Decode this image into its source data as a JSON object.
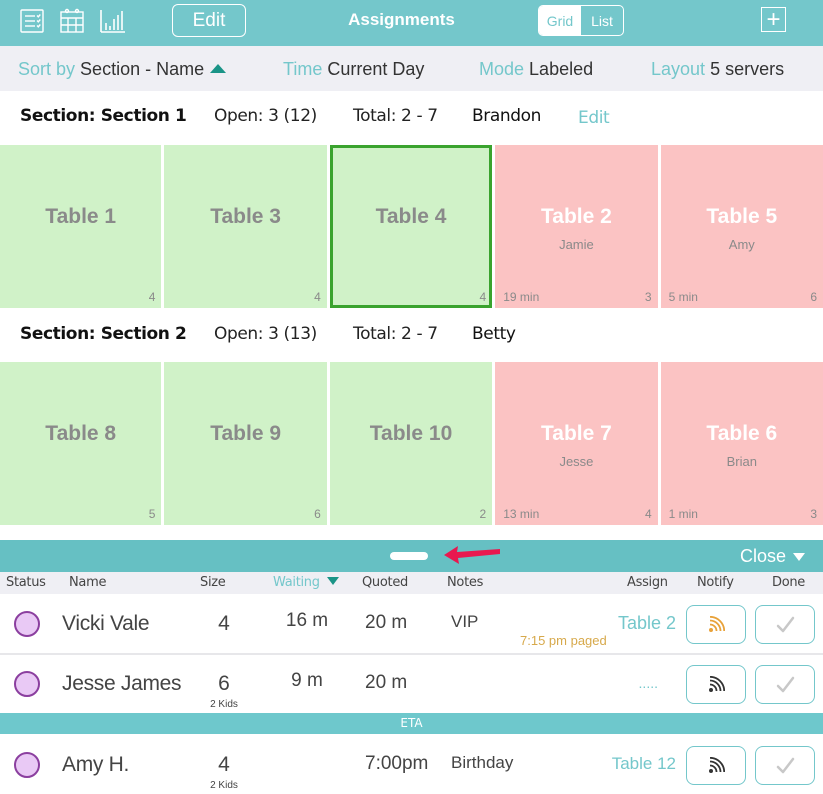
{
  "topbar": {
    "title": "Assignments",
    "edit_label": "Edit",
    "view_toggle": {
      "options": [
        "Grid",
        "List"
      ],
      "selected": "Grid"
    },
    "add_label": "+",
    "icons": [
      "waitlist-icon",
      "calendar-icon",
      "chart-icon",
      "add-icon"
    ]
  },
  "filters": {
    "sort": {
      "label": "Sort by",
      "value": "Section - Name",
      "direction": "ascending"
    },
    "time": {
      "label": "Time",
      "value": "Current Day"
    },
    "mode": {
      "label": "Mode",
      "value": "Labeled"
    },
    "layout": {
      "label": "Layout",
      "value": "5 servers"
    }
  },
  "sections": [
    {
      "name": "Section: Section 1",
      "open": "Open: 3 (12)",
      "total": "Total: 2 - 7",
      "server": "Brandon",
      "edit_label": "Edit",
      "tables": [
        {
          "name": "Table 1",
          "capacity": "4",
          "state": "open",
          "server": "",
          "time": "",
          "selected": false
        },
        {
          "name": "Table 3",
          "capacity": "4",
          "state": "open",
          "server": "",
          "time": "",
          "selected": false
        },
        {
          "name": "Table 4",
          "capacity": "4",
          "state": "open",
          "server": "",
          "time": "",
          "selected": true
        },
        {
          "name": "Table 2",
          "capacity": "3",
          "state": "occupied",
          "server": "Jamie",
          "time": "19 min",
          "selected": false
        },
        {
          "name": "Table 5",
          "capacity": "6",
          "state": "occupied",
          "server": "Amy",
          "time": "5 min",
          "selected": false
        }
      ]
    },
    {
      "name": "Section: Section 2",
      "open": "Open: 3 (13)",
      "total": "Total: 2 - 7",
      "server": "Betty",
      "tables": [
        {
          "name": "Table 8",
          "capacity": "5",
          "state": "open",
          "server": "",
          "time": "",
          "selected": false
        },
        {
          "name": "Table 9",
          "capacity": "6",
          "state": "open",
          "server": "",
          "time": "",
          "selected": false
        },
        {
          "name": "Table 10",
          "capacity": "2",
          "state": "open",
          "server": "",
          "time": "",
          "selected": false
        },
        {
          "name": "Table 7",
          "capacity": "4",
          "state": "occupied",
          "server": "Jesse",
          "time": "13 min",
          "selected": false
        },
        {
          "name": "Table 6",
          "capacity": "3",
          "state": "occupied",
          "server": "Brian",
          "time": "1 min",
          "selected": false
        }
      ]
    }
  ],
  "waitlist": {
    "close_label": "Close",
    "columns": {
      "status": "Status",
      "name": "Name",
      "size": "Size",
      "waiting": "Waiting",
      "quoted": "Quoted",
      "notes": "Notes",
      "assign": "Assign",
      "notify": "Notify",
      "done": "Done"
    },
    "sorted_column": "Waiting",
    "rows": [
      {
        "name": "Vicki Vale",
        "size": "4",
        "kids": "",
        "waiting": "16 m",
        "quoted": "20 m",
        "notes": "VIP",
        "assign": "Table 2",
        "paged": "7:15 pm paged",
        "notify_state": "paged"
      },
      {
        "name": "Jesse James",
        "size": "6",
        "kids": "2 Kids",
        "waiting": "9 m",
        "quoted": "20 m",
        "notes": "",
        "assign": ".....",
        "paged": "",
        "notify_state": "idle"
      }
    ],
    "eta_label": "ETA",
    "eta_rows": [
      {
        "name": "Amy H.",
        "size": "4",
        "kids": "2 Kids",
        "waiting": "",
        "quoted": "7:00pm",
        "notes": "Birthday",
        "assign": "Table 12",
        "paged": "",
        "notify_state": "idle"
      }
    ]
  },
  "colors": {
    "accent": "#74c7cb",
    "drawer": "#66c0c3",
    "open_table": "#d0f2c8",
    "occupied_table": "#fbc3c3",
    "selected_border": "#3aa32e",
    "status_fill": "#e9c9f5",
    "status_border": "#8b3f9f",
    "paged": "#d7a94b",
    "annotation_arrow": "#e8184f"
  }
}
